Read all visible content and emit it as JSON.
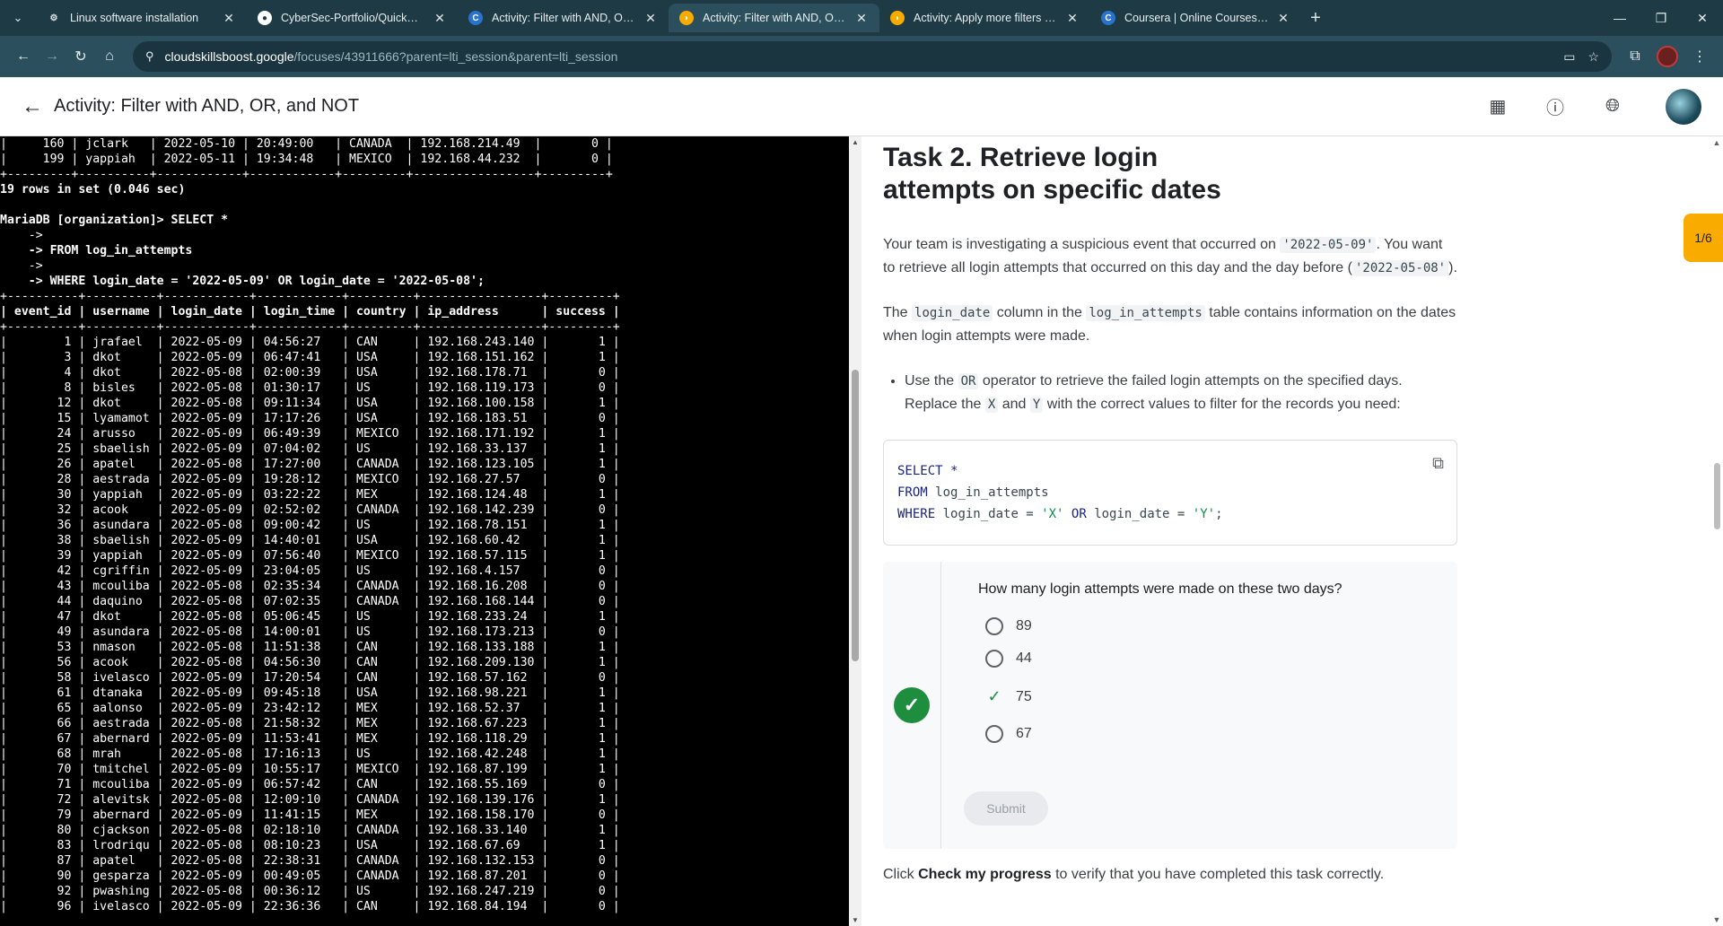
{
  "browser": {
    "tabs": [
      {
        "title": "Linux software installation",
        "icon": "gear-icon",
        "icon_color": "#dfe6e8",
        "active": false
      },
      {
        "title": "CyberSec-Portfolio/QuickWins",
        "icon": "github-icon",
        "icon_color": "#ffffff",
        "active": false
      },
      {
        "title": "Activity: Filter with AND, OR, and NOT",
        "icon": "coursera-icon",
        "icon_color": "#2a73cc",
        "active": false
      },
      {
        "title": "Activity: Filter with AND, OR, and NOT",
        "icon": "cloudskillsboost-icon",
        "icon_color": "#f9ab00",
        "active": true
      },
      {
        "title": "Activity: Apply more filters in SQL",
        "icon": "cloudskillsboost-icon",
        "icon_color": "#f9ab00",
        "active": false
      },
      {
        "title": "Coursera | Online Courses From",
        "icon": "coursera-icon",
        "icon_color": "#2a73cc",
        "active": false
      }
    ],
    "url_host": "cloudskillsboost.google",
    "url_path": "/focuses/43911666?parent=lti_session&parent=lti_session"
  },
  "header": {
    "title": "Activity: Filter with AND, OR, and NOT"
  },
  "terminal": {
    "lines": [
      "|     160 | jclark   | 2022-05-10 | 20:49:00   | CANADA  | 192.168.214.49  |       0 |",
      "|     199 | yappiah  | 2022-05-11 | 19:34:48   | MEXICO  | 192.168.44.232  |       0 |",
      "+---------+----------+------------+------------+---------+-----------------+---------+",
      "19 rows in set (0.046 sec)",
      "",
      "MariaDB [organization]> SELECT *",
      "    ->",
      "    -> FROM log_in_attempts",
      "    ->",
      "    -> WHERE login_date = '2022-05-09' OR login_date = '2022-05-08';",
      "+----------+----------+------------+------------+---------+-----------------+---------+",
      "| event_id | username | login_date | login_time | country | ip_address      | success |",
      "+----------+----------+------------+------------+---------+-----------------+---------+",
      "|        1 | jrafael  | 2022-05-09 | 04:56:27   | CAN     | 192.168.243.140 |       1 |",
      "|        3 | dkot     | 2022-05-09 | 06:47:41   | USA     | 192.168.151.162 |       1 |",
      "|        4 | dkot     | 2022-05-08 | 02:00:39   | USA     | 192.168.178.71  |       0 |",
      "|        8 | bisles   | 2022-05-08 | 01:30:17   | US      | 192.168.119.173 |       0 |",
      "|       12 | dkot     | 2022-05-08 | 09:11:34   | USA     | 192.168.100.158 |       1 |",
      "|       15 | lyamamot | 2022-05-09 | 17:17:26   | USA     | 192.168.183.51  |       0 |",
      "|       24 | arusso   | 2022-05-09 | 06:49:39   | MEXICO  | 192.168.171.192 |       1 |",
      "|       25 | sbaelish | 2022-05-09 | 07:04:02   | US      | 192.168.33.137  |       1 |",
      "|       26 | apatel   | 2022-05-08 | 17:27:00   | CANADA  | 192.168.123.105 |       1 |",
      "|       28 | aestrada | 2022-05-09 | 19:28:12   | MEXICO  | 192.168.27.57   |       0 |",
      "|       30 | yappiah  | 2022-05-09 | 03:22:22   | MEX     | 192.168.124.48  |       1 |",
      "|       32 | acook    | 2022-05-09 | 02:52:02   | CANADA  | 192.168.142.239 |       0 |",
      "|       36 | asundara | 2022-05-08 | 09:00:42   | US      | 192.168.78.151  |       1 |",
      "|       38 | sbaelish | 2022-05-09 | 14:40:01   | USA     | 192.168.60.42   |       1 |",
      "|       39 | yappiah  | 2022-05-09 | 07:56:40   | MEXICO  | 192.168.57.115  |       1 |",
      "|       42 | cgriffin | 2022-05-09 | 23:04:05   | US      | 192.168.4.157   |       0 |",
      "|       43 | mcouliba | 2022-05-08 | 02:35:34   | CANADA  | 192.168.16.208  |       0 |",
      "|       44 | daquino  | 2022-05-08 | 07:02:35   | CANADA  | 192.168.168.144 |       0 |",
      "|       47 | dkot     | 2022-05-08 | 05:06:45   | US      | 192.168.233.24  |       1 |",
      "|       49 | asundara | 2022-05-08 | 14:00:01   | US      | 192.168.173.213 |       0 |",
      "|       53 | nmason   | 2022-05-08 | 11:51:38   | CAN     | 192.168.133.188 |       1 |",
      "|       56 | acook    | 2022-05-08 | 04:56:30   | CAN     | 192.168.209.130 |       1 |",
      "|       58 | ivelasco | 2022-05-09 | 17:20:54   | CAN     | 192.168.57.162  |       0 |",
      "|       61 | dtanaka  | 2022-05-09 | 09:45:18   | USA     | 192.168.98.221  |       1 |",
      "|       65 | aalonso  | 2022-05-09 | 23:42:12   | MEX     | 192.168.52.37   |       1 |",
      "|       66 | aestrada | 2022-05-08 | 21:58:32   | MEX     | 192.168.67.223  |       1 |",
      "|       67 | abernard | 2022-05-09 | 11:53:41   | MEX     | 192.168.118.29  |       1 |",
      "|       68 | mrah     | 2022-05-08 | 17:16:13   | US      | 192.168.42.248  |       1 |",
      "|       70 | tmitchel | 2022-05-09 | 10:55:17   | MEXICO  | 192.168.87.199  |       1 |",
      "|       71 | mcouliba | 2022-05-09 | 06:57:42   | CAN     | 192.168.55.169  |       0 |",
      "|       72 | alevitsk | 2022-05-08 | 12:09:10   | CANADA  | 192.168.139.176 |       1 |",
      "|       79 | abernard | 2022-05-09 | 11:41:15   | MEX     | 192.168.158.170 |       0 |",
      "|       80 | cjackson | 2022-05-08 | 02:18:10   | CANADA  | 192.168.33.140  |       1 |",
      "|       83 | lrodriqu | 2022-05-08 | 08:10:23   | USA     | 192.168.67.69   |       1 |",
      "|       87 | apatel   | 2022-05-08 | 22:38:31   | CANADA  | 192.168.132.153 |       0 |",
      "|       90 | gesparza | 2022-05-09 | 00:49:05   | CANADA  | 192.168.87.201  |       0 |",
      "|       92 | pwashing | 2022-05-08 | 00:36:12   | US      | 192.168.247.219 |       0 |",
      "|       96 | ivelasco | 2022-05-09 | 22:36:36   | CAN     | 192.168.84.194  |       0 |"
    ]
  },
  "instructions": {
    "task_title": "Task 2. Retrieve login attempts on specific dates",
    "para1_a": "Your team is investigating a suspicious event that occurred on ",
    "para1_code1": "'2022-05-09'",
    "para1_b": ". You want to retrieve all login attempts that occurred on this day and the day before (",
    "para1_code2": "'2022-05-08'",
    "para1_c": ").",
    "para2_a": "The ",
    "para2_code1": "login_date",
    "para2_b": " column in the ",
    "para2_code2": "log_in_attempts",
    "para2_c": " table contains information on the dates when login attempts were made.",
    "bullet_a": "Use the ",
    "bullet_code1": "OR",
    "bullet_b": " operator to retrieve the failed login attempts on the specified days. Replace the ",
    "bullet_code2": "X",
    "bullet_c": " and ",
    "bullet_code3": "Y",
    "bullet_d": " with the correct values to filter for the records you need:",
    "code": {
      "line1_kw": "SELECT *",
      "line2_kw": "FROM",
      "line2_rest": " log_in_attempts",
      "line3_kw": "WHERE",
      "line3_a": " login_date = ",
      "line3_x": "'X'",
      "line3_or": " OR",
      "line3_b": " login_date = ",
      "line3_y": "'Y'",
      "line3_end": ";"
    },
    "quiz": {
      "question": "How many login attempts were made on these two days?",
      "options": [
        "89",
        "44",
        "75",
        "67"
      ],
      "selected": "75",
      "submit_label": "Submit"
    },
    "progress_a": "Click ",
    "progress_bold": "Check my progress",
    "progress_b": " to verify that you have completed this task correctly."
  },
  "page_badge": "1/6"
}
